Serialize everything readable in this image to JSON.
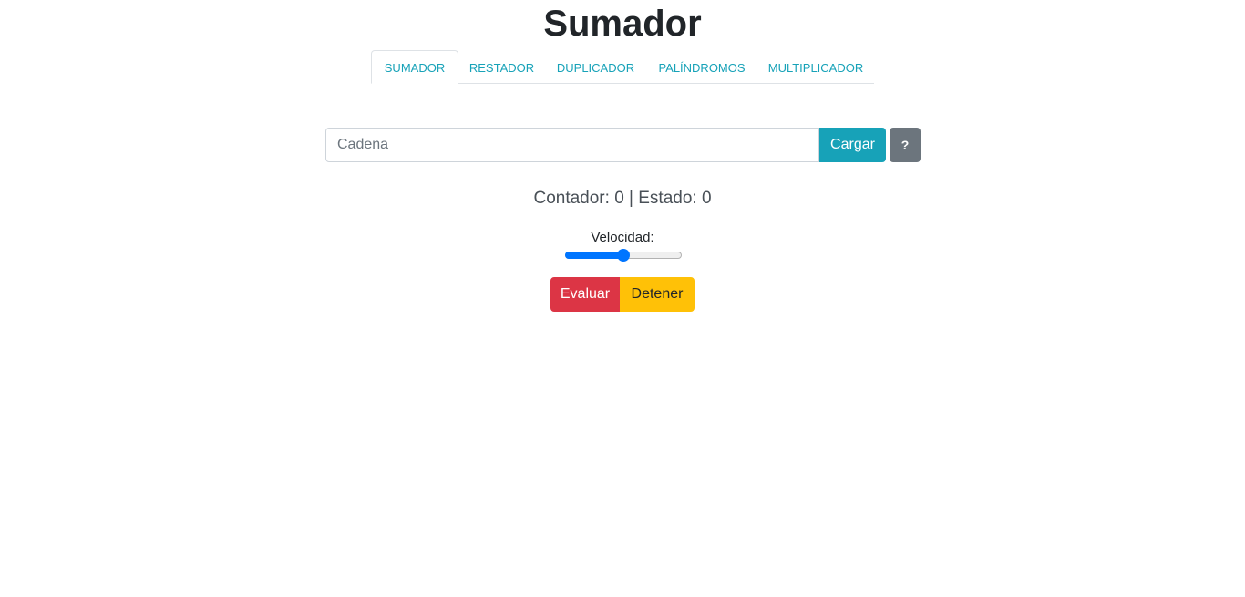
{
  "page": {
    "title": "Sumador"
  },
  "tabs": [
    {
      "label": "SUMADOR",
      "active": true
    },
    {
      "label": "RESTADOR",
      "active": false
    },
    {
      "label": "DUPLICADOR",
      "active": false
    },
    {
      "label": "PALÍNDROMOS",
      "active": false
    },
    {
      "label": "MULTIPLICADOR",
      "active": false
    }
  ],
  "input": {
    "placeholder": "Cadena",
    "value": ""
  },
  "buttons": {
    "load_label": "Cargar",
    "help_label": "?",
    "evaluate_label": "Evaluar",
    "stop_label": "Detener"
  },
  "status": {
    "text": "Contador: 0 | Estado: 0"
  },
  "speed": {
    "label": "Velocidad:",
    "value": 0.5
  },
  "colors": {
    "tab_text": "#17a2b8",
    "load_button": "#17a2b8",
    "help_button": "#6c757d",
    "evaluate_button": "#dc3545",
    "stop_button": "#ffc107",
    "slider_accent": "#0075ff"
  }
}
